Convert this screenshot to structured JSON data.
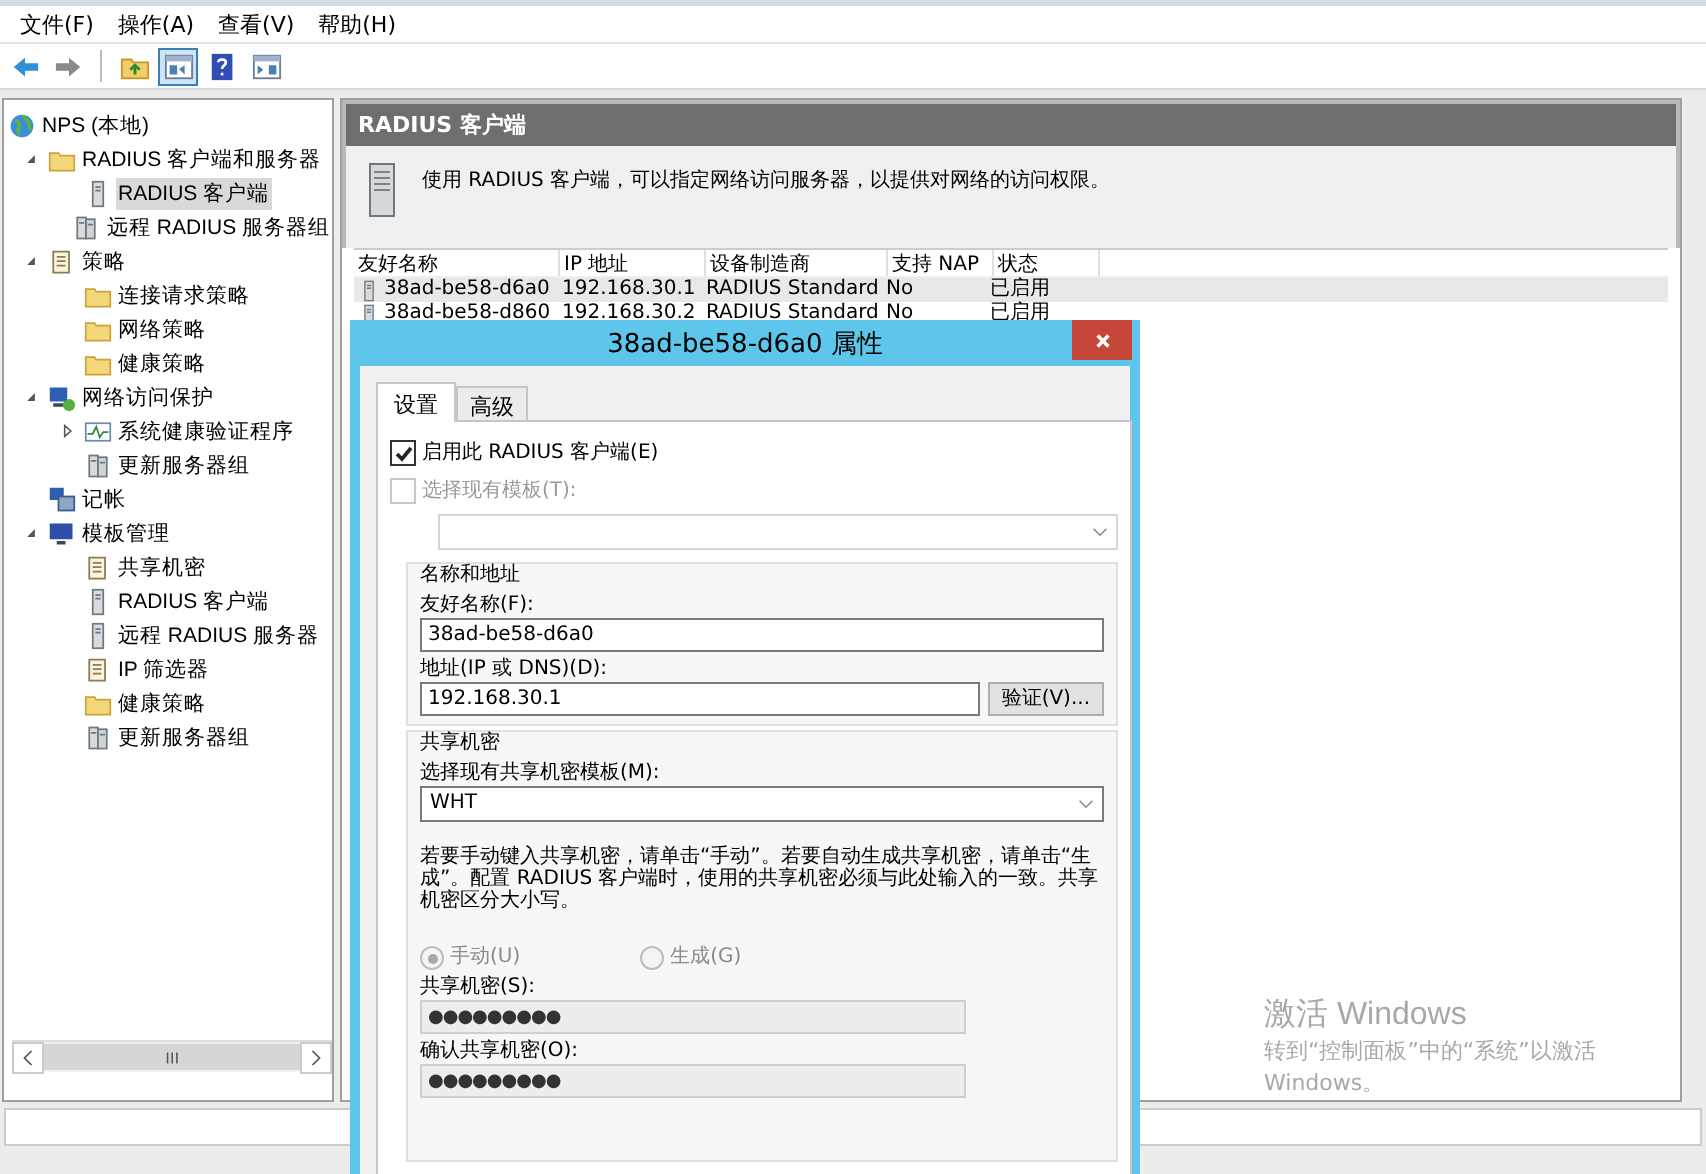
{
  "menu": [
    "文件(F)",
    "操作(A)",
    "查看(V)",
    "帮助(H)"
  ],
  "toolbar": [
    {
      "kind": "back",
      "on": false
    },
    {
      "kind": "forward",
      "on": false
    },
    {
      "kind": "separator"
    },
    {
      "kind": "up",
      "on": false
    },
    {
      "kind": "tree",
      "on": true
    },
    {
      "kind": "help",
      "on": false
    },
    {
      "kind": "pane",
      "on": false
    }
  ],
  "tree": [
    {
      "label": "NPS (本地)",
      "kind": "globe",
      "selected": false,
      "children": [
        {
          "label": "RADIUS 客户端和服务器",
          "kind": "folder",
          "expanded": true,
          "selected": false,
          "children": [
            {
              "label": "RADIUS 客户端",
              "kind": "server",
              "selected": true
            },
            {
              "label": "远程 RADIUS 服务器组",
              "kind": "servers",
              "selected": false
            }
          ]
        },
        {
          "label": "策略",
          "kind": "document",
          "expanded": true,
          "selected": false,
          "children": [
            {
              "label": "连接请求策略",
              "kind": "folder",
              "selected": false
            },
            {
              "label": "网络策略",
              "kind": "folder",
              "selected": false
            },
            {
              "label": "健康策略",
              "kind": "folder",
              "selected": false
            }
          ]
        },
        {
          "label": "网络访问保护",
          "kind": "computer",
          "expanded": true,
          "selected": false,
          "children": [
            {
              "label": "系统健康验证程序",
              "kind": "pulse",
              "expanded": false,
              "selected": false
            },
            {
              "label": "更新服务器组",
              "kind": "servers",
              "selected": false
            }
          ]
        },
        {
          "label": "记帐",
          "kind": "computers",
          "selected": false
        },
        {
          "label": "模板管理",
          "kind": "monitor",
          "expanded": true,
          "selected": false,
          "children": [
            {
              "label": "共享机密",
              "kind": "document",
              "selected": false
            },
            {
              "label": "RADIUS 客户端",
              "kind": "server",
              "selected": false
            },
            {
              "label": "远程 RADIUS 服务器",
              "kind": "server",
              "selected": false
            },
            {
              "label": "IP 筛选器",
              "kind": "document",
              "selected": false
            },
            {
              "label": "健康策略",
              "kind": "folder",
              "selected": false
            },
            {
              "label": "更新服务器组",
              "kind": "servers",
              "selected": false
            }
          ]
        }
      ]
    }
  ],
  "content": {
    "header": "RADIUS 客户端",
    "description": "使用 RADIUS 客户端，可以指定网络访问服务器，以提供对网络的访问权限。",
    "table": {
      "columns": [
        "友好名称",
        "IP 地址",
        "设备制造商",
        "支持 NAP",
        "状态"
      ],
      "rows": [
        {
          "cells": [
            "38ad-be58-d6a0",
            "192.168.30.1",
            "RADIUS Standard",
            "No",
            "已启用"
          ],
          "selected": true
        },
        {
          "cells": [
            "38ad-be58-d860",
            "192.168.30.2",
            "RADIUS Standard",
            "No",
            "已启用"
          ],
          "selected": false
        }
      ]
    }
  },
  "activation_notice": {
    "title": "激活 Windows",
    "text": "转到“控制面板”中的“系统”以激活 Windows。"
  },
  "dialog": {
    "title": "38ad-be58-d6a0 属性",
    "tabs": [
      {
        "label": "设置",
        "selected": true
      },
      {
        "label": "高级",
        "selected": false
      }
    ],
    "enable_checkbox": {
      "label": "启用此 RADIUS 客户端(E)",
      "checked": true,
      "disabled": false
    },
    "template_checkbox": {
      "label": "选择现有模板(T):",
      "checked": false,
      "disabled": true
    },
    "template_select": {
      "disabled": true
    },
    "name_group": {
      "title": "名称和地址",
      "friendly_name": {
        "label": "友好名称(F):",
        "value": "38ad-be58-d6a0"
      },
      "address": {
        "label": "地址(IP 或 DNS)(D):",
        "value": "192.168.30.1"
      },
      "verify_button": "验证(V)..."
    },
    "secret_group": {
      "title": "共享机密",
      "template_label": "选择现有共享机密模板(M):",
      "template_value": "WHT",
      "help": "若要手动键入共享机密，请单击“手动”。若要自动生成共享机密，请单击“生成”。配置 RADIUS 客户端时，使用的共享机密必须与此处输入的一致。共享机密区分大小写。",
      "modes": [
        {
          "label": "手动(U)",
          "selected": true,
          "disabled": true
        },
        {
          "label": "生成(G)",
          "selected": false,
          "disabled": true
        }
      ],
      "secret": {
        "label": "共享机密(S):",
        "value": "●●●●●●●●●"
      },
      "confirm": {
        "label": "确认共享机密(O):",
        "value": "●●●●●●●●●"
      }
    }
  }
}
